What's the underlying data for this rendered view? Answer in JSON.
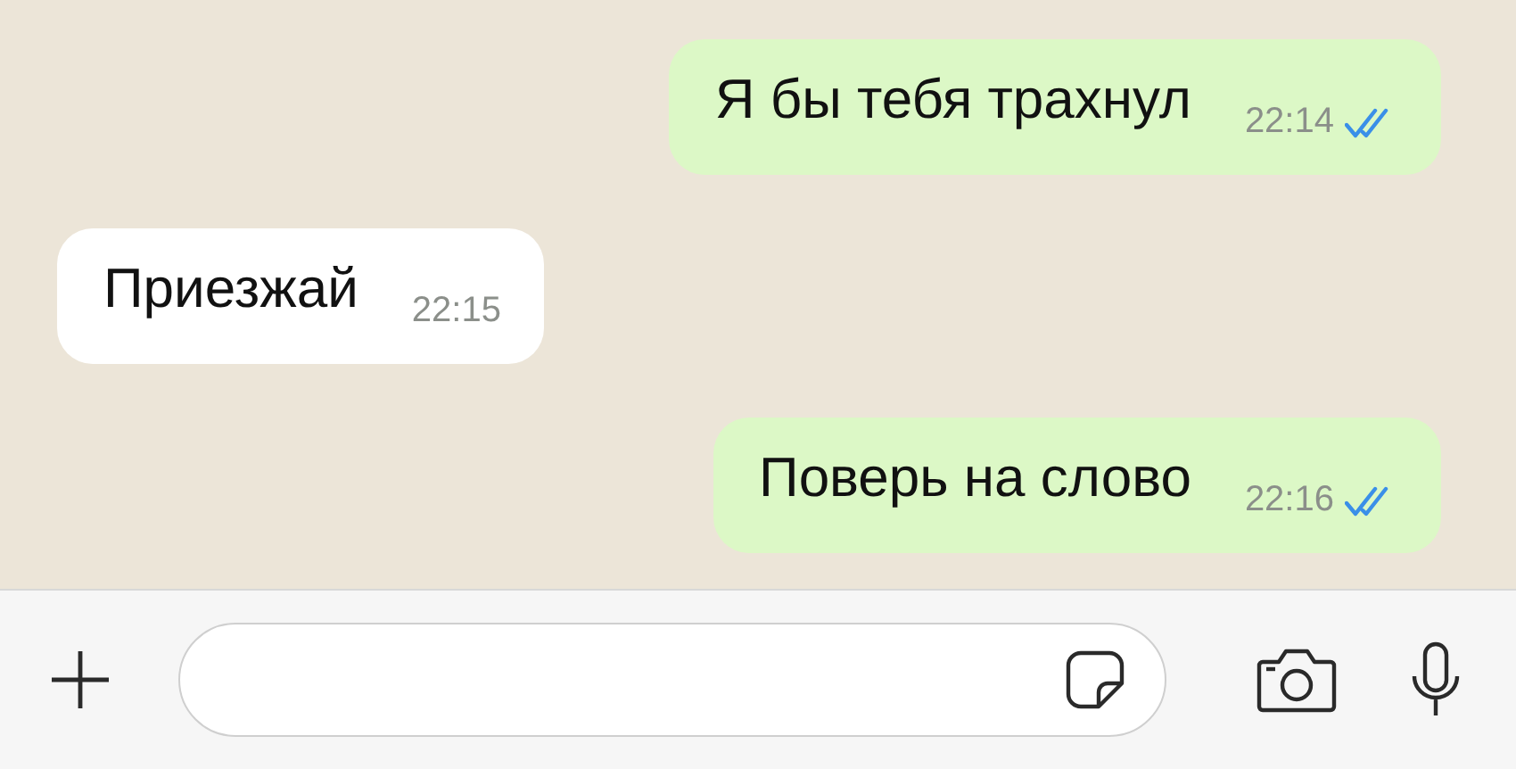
{
  "messages": [
    {
      "kind": "outgoing",
      "text": "Я бы тебя трахнул",
      "time": "22:14",
      "read": true
    },
    {
      "kind": "incoming",
      "text": "Приезжай",
      "time": "22:15"
    },
    {
      "kind": "outgoing",
      "text": "Поверь на слово",
      "time": "22:16",
      "read": true
    }
  ]
}
